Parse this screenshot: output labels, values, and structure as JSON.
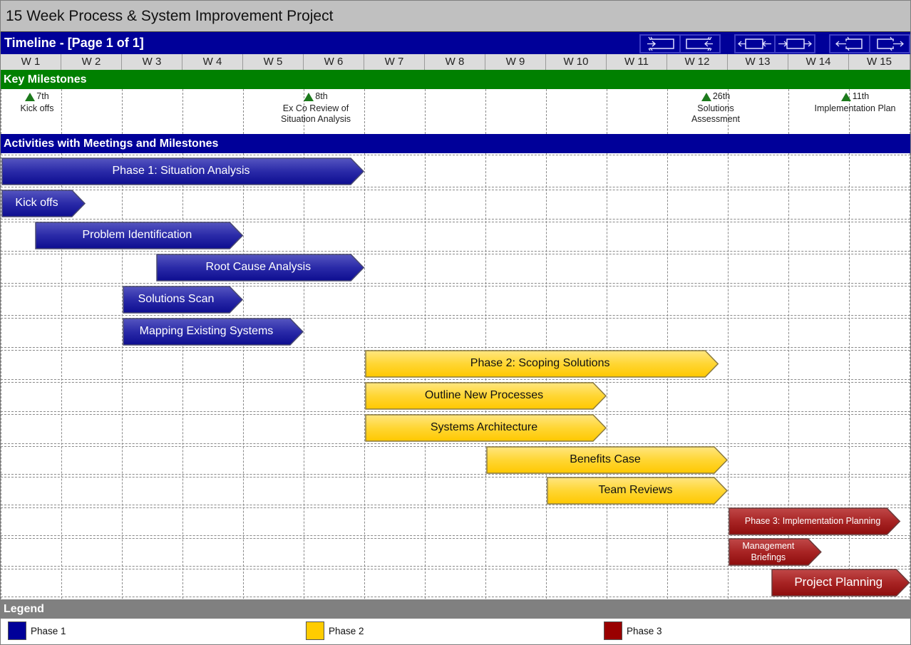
{
  "title": "15 Week Process & System Improvement Project",
  "timeline": {
    "title": "Timeline - [Page 1 of 1]",
    "nav_buttons": [
      {
        "name": "shrink-left-button",
        "icon": "collapse-left-icon"
      },
      {
        "name": "shrink-right-button",
        "icon": "collapse-right-icon"
      },
      {
        "name": "move-left-button",
        "icon": "shift-left-icon"
      },
      {
        "name": "move-right-button",
        "icon": "shift-right-icon"
      },
      {
        "name": "expand-left-button",
        "icon": "expand-left-icon"
      },
      {
        "name": "expand-right-button",
        "icon": "expand-right-icon"
      }
    ]
  },
  "weeks": [
    "W 1",
    "W 2",
    "W 3",
    "W 4",
    "W 5",
    "W 6",
    "W 7",
    "W 8",
    "W 9",
    "W 10",
    "W 11",
    "W 12",
    "W 13",
    "W 14",
    "W 15"
  ],
  "sections": {
    "milestones": "Key Milestones",
    "activities": "Activities with Meetings and Milestones",
    "legend": "Legend"
  },
  "milestones": [
    {
      "date": "7th",
      "label": "Kick offs",
      "week": 1.6
    },
    {
      "date": "8th",
      "label": "Ex Co Review of Situation Analysis",
      "week": 6.2
    },
    {
      "date": "26th",
      "label": "Solutions Assessment",
      "week": 12.8
    },
    {
      "date": "11th",
      "label": "Implementation Plan",
      "week": 15.1
    }
  ],
  "colors": {
    "phase1": "#000099",
    "phase2": "#ffcc00",
    "phase3": "#990000",
    "milestone": "#1c7a1c",
    "section_green": "#008000",
    "section_blue": "#000099",
    "legend_header": "#808080"
  },
  "activities": [
    {
      "label": "Phase 1: Situation Analysis",
      "phase": 1,
      "start": 1.0,
      "end": 7.0
    },
    {
      "label": "Kick offs",
      "phase": 1,
      "start": 1.0,
      "end": 2.4,
      "align": "left"
    },
    {
      "label": "Problem Identification",
      "phase": 1,
      "start": 1.55,
      "end": 5.0
    },
    {
      "label": "Root Cause Analysis",
      "phase": 1,
      "start": 3.55,
      "end": 7.0
    },
    {
      "label": "Solutions Scan",
      "phase": 1,
      "start": 3.0,
      "end": 5.0,
      "align": "left"
    },
    {
      "label": "Mapping Existing Systems",
      "phase": 1,
      "start": 3.0,
      "end": 6.0,
      "align": "left"
    },
    {
      "label": "Phase 2: Scoping Solutions",
      "phase": 2,
      "start": 7.0,
      "end": 12.85
    },
    {
      "label": "Outline New Processes",
      "phase": 2,
      "start": 7.0,
      "end": 11.0
    },
    {
      "label": "Systems Architecture",
      "phase": 2,
      "start": 7.0,
      "end": 11.0
    },
    {
      "label": "Benefits Case",
      "phase": 2,
      "start": 9.0,
      "end": 13.0
    },
    {
      "label": "Team Reviews",
      "phase": 2,
      "start": 10.0,
      "end": 13.0
    },
    {
      "label": "Phase 3: Implementation Planning",
      "phase": 3,
      "start": 13.0,
      "end": 15.85,
      "size": "small"
    },
    {
      "label": "Management Briefings",
      "phase": 3,
      "start": 13.0,
      "end": 14.55,
      "size": "small",
      "align": "left"
    },
    {
      "label": "Project Planning",
      "phase": 3,
      "start": 13.7,
      "end": 16.0,
      "size": "big"
    }
  ],
  "legend": [
    {
      "label": "Phase 1",
      "color": "#000099"
    },
    {
      "label": "Phase 2",
      "color": "#ffcc00"
    },
    {
      "label": "Phase 3",
      "color": "#990000"
    }
  ]
}
